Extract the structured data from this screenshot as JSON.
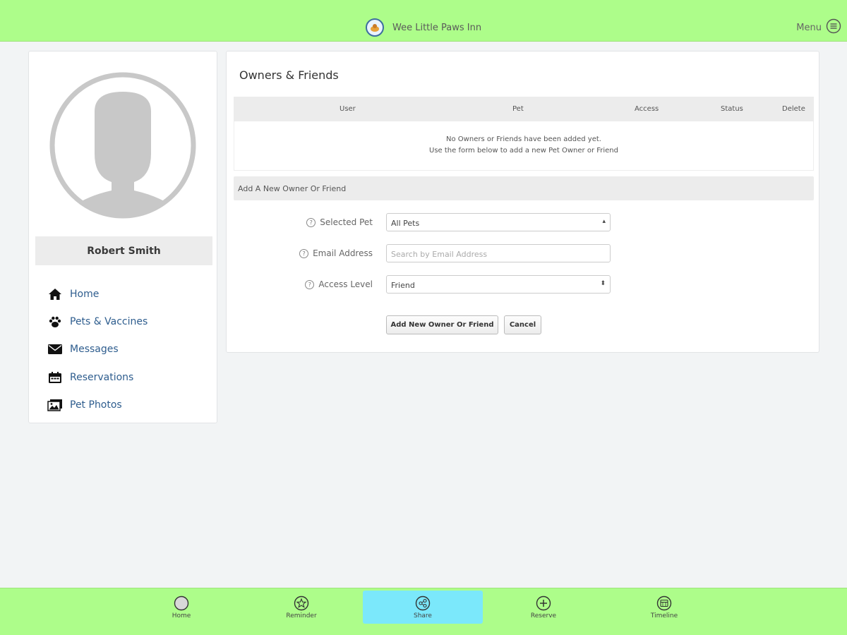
{
  "header": {
    "app_title": "Wee Little Paws Inn",
    "menu_label": "Menu"
  },
  "sidebar": {
    "user_name": "Robert Smith",
    "nav_items": [
      {
        "label": "Home",
        "icon": "home-icon"
      },
      {
        "label": "Pets & Vaccines",
        "icon": "paw-icon"
      },
      {
        "label": "Messages",
        "icon": "envelope-icon"
      },
      {
        "label": "Reservations",
        "icon": "calendar-icon"
      },
      {
        "label": "Pet Photos",
        "icon": "photos-icon"
      }
    ]
  },
  "main": {
    "title": "Owners & Friends",
    "table": {
      "columns": [
        "User",
        "Pet",
        "Access",
        "Status",
        "Delete"
      ],
      "empty_line1": "No Owners or Friends have been added yet.",
      "empty_line2": "Use the form below to add a new Pet Owner or Friend"
    },
    "form": {
      "heading": "Add A New Owner Or Friend",
      "selected_pet_label": "Selected Pet",
      "selected_pet_value": "All Pets",
      "email_label": "Email Address",
      "email_placeholder": "Search by Email Address",
      "access_label": "Access Level",
      "access_value": "Friend",
      "submit_label": "Add New Owner Or Friend",
      "cancel_label": "Cancel"
    }
  },
  "bottom_nav": {
    "tabs": [
      {
        "label": "Home",
        "icon": "circle-icon",
        "active": false
      },
      {
        "label": "Reminder",
        "icon": "star-icon",
        "active": false
      },
      {
        "label": "Share",
        "icon": "share-icon",
        "active": true
      },
      {
        "label": "Reserve",
        "icon": "plus-icon",
        "active": false
      },
      {
        "label": "Timeline",
        "icon": "timeline-icon",
        "active": false
      }
    ]
  },
  "colors": {
    "bar_green": "#adfd8a",
    "active_tab": "#7be8fb",
    "link_blue": "#2e5d8e"
  }
}
